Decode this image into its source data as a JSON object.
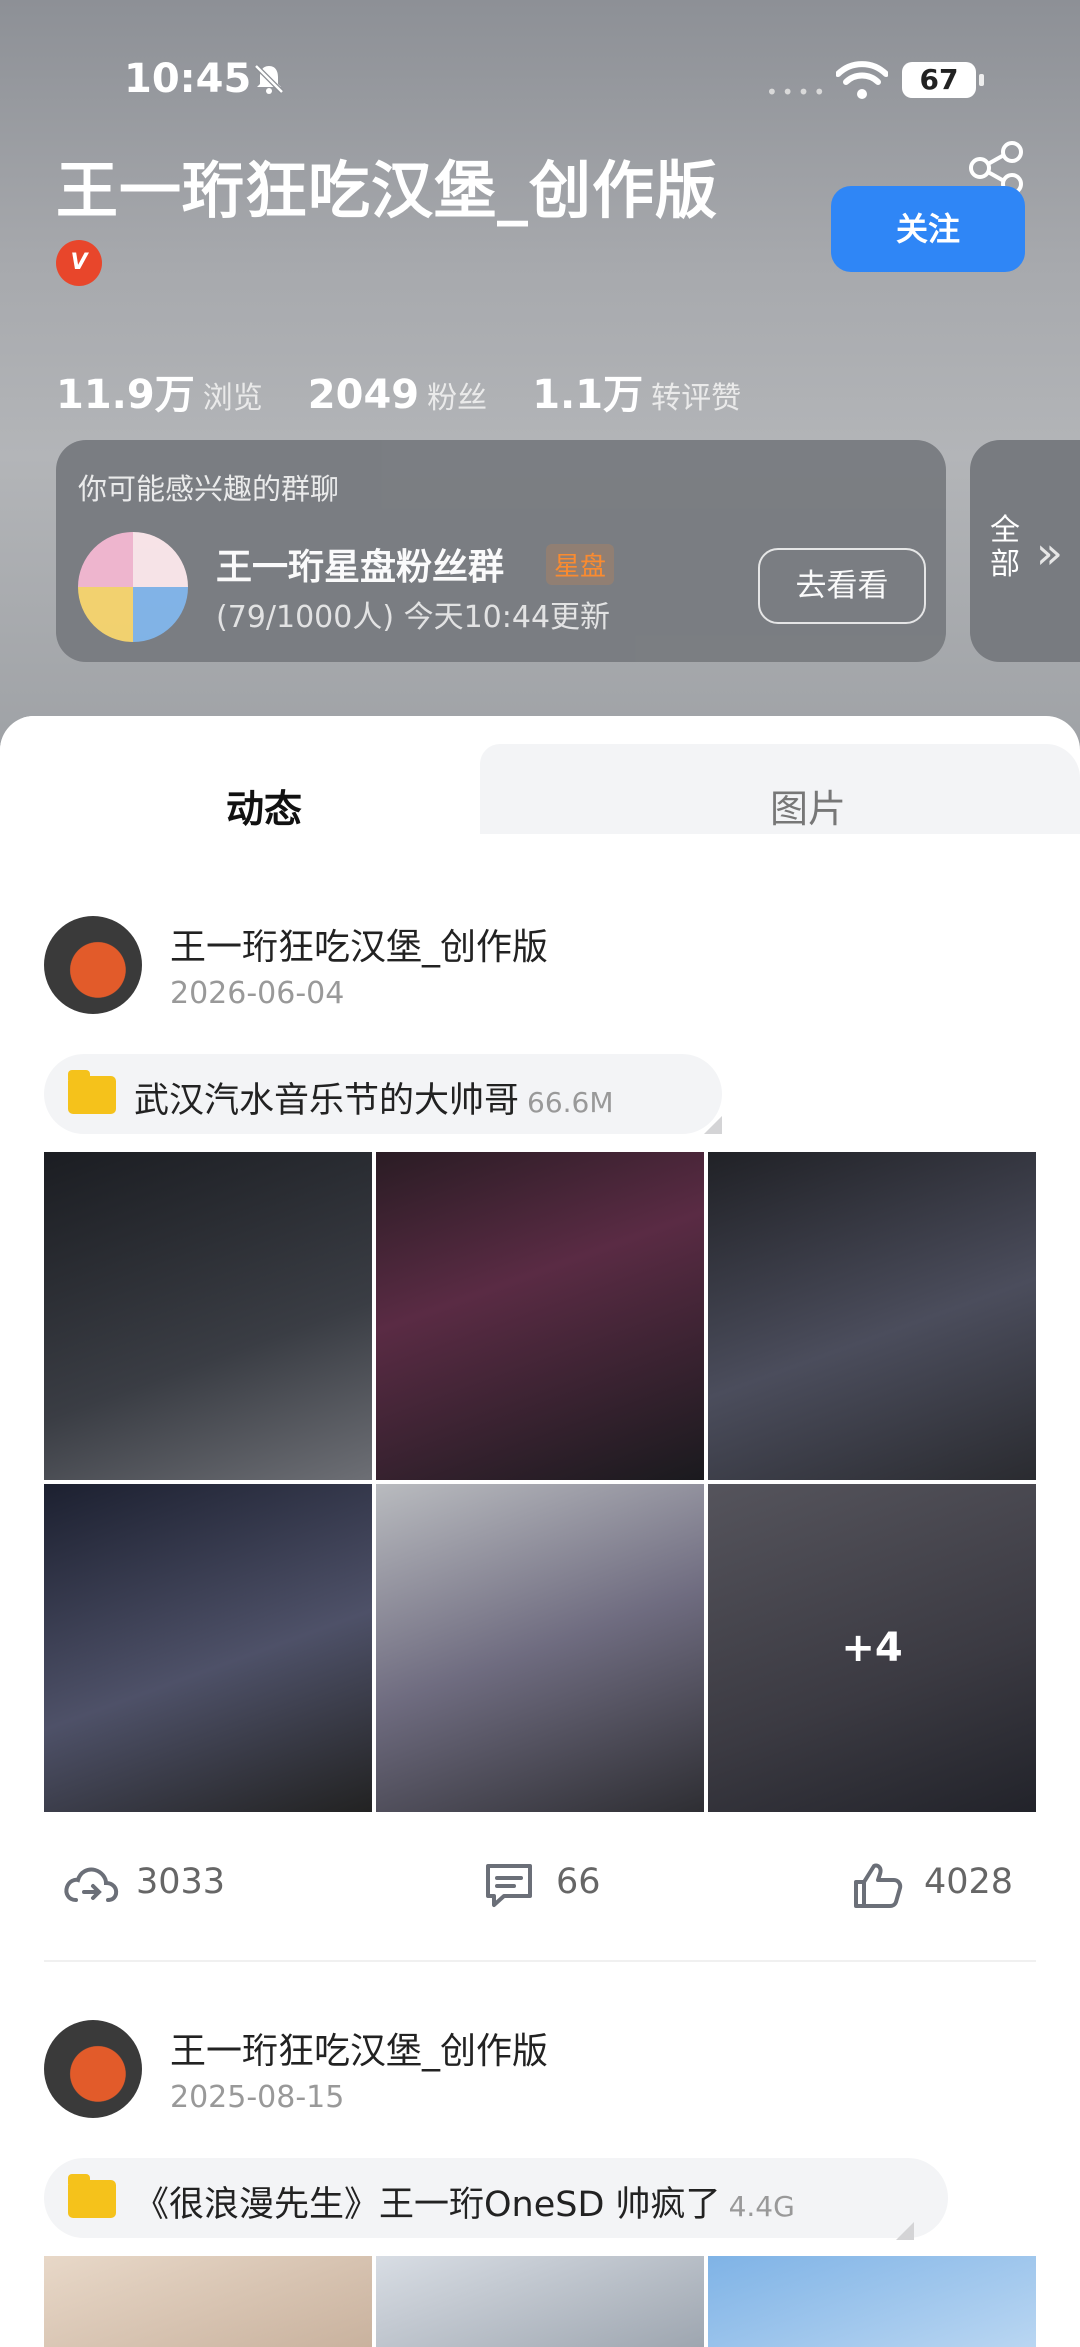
{
  "status_bar": {
    "time": "10:45",
    "battery": "67"
  },
  "profile": {
    "name": "王一珩狂吃汉堡_创作版",
    "badge": "V",
    "follow_label": "关注",
    "stats": [
      {
        "value": "11.9万",
        "label": "浏览"
      },
      {
        "value": "2049",
        "label": "粉丝"
      },
      {
        "value": "1.1万",
        "label": "转评赞"
      }
    ]
  },
  "group_card": {
    "hint": "你可能感兴趣的群聊",
    "name": "王一珩星盘粉丝群",
    "tag": "星盘",
    "info": "(79/1000人) 今天10:44更新",
    "button": "去看看",
    "all_label": "全部"
  },
  "tabs": [
    {
      "label": "动态",
      "active": true
    },
    {
      "label": "图片",
      "active": false
    }
  ],
  "posts": [
    {
      "author": "王一珩狂吃汉堡_创作版",
      "date": "2026-06-04",
      "folder_name": "武汉汽水音乐节的大帅哥",
      "folder_size": "66.6M",
      "more_count": "+4",
      "shares": "3033",
      "comments": "66",
      "likes": "4028"
    },
    {
      "author": "王一珩狂吃汉堡_创作版",
      "date": "2025-08-15",
      "folder_name": "《很浪漫先生》王一珩OneSD 帅疯了",
      "folder_size": "4.4G"
    }
  ],
  "colors": {
    "accent": "#2f86f6",
    "tag_orange": "#ff8a2a",
    "folder_yellow": "#f5c21b"
  }
}
